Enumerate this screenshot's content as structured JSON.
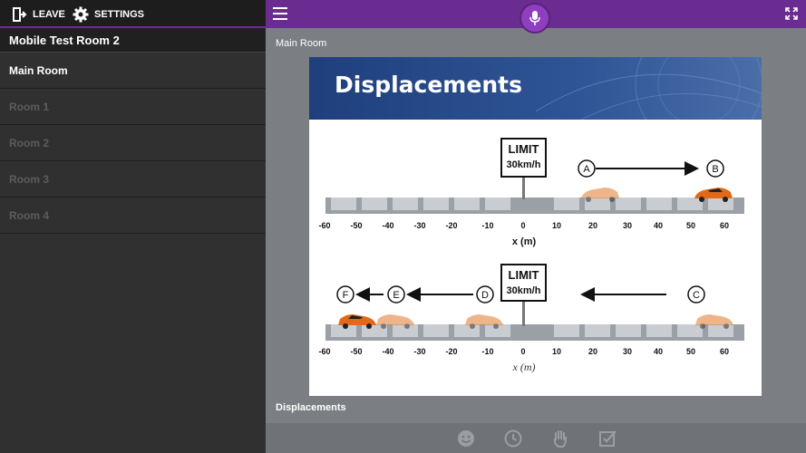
{
  "left_panel": {
    "leave_label": "LEAVE",
    "settings_label": "SETTINGS",
    "room_title": "Mobile Test Room 2",
    "rooms": [
      "Main Room",
      "Room 1",
      "Room 2",
      "Room 3",
      "Room 4"
    ]
  },
  "main": {
    "presentation_label": "Main Room",
    "footer_title": "Displacements",
    "slide": {
      "title": "Displacements",
      "sign_line1": "LIMIT",
      "sign_line2": "30km/h",
      "axis_ticks": [
        "-60",
        "-50",
        "-40",
        "-30",
        "-20",
        "-10",
        "0",
        "10",
        "20",
        "30",
        "40",
        "50",
        "60"
      ],
      "axis_label_top": "x (m)",
      "axis_label_bottom": "x (m)",
      "points_top": [
        "A",
        "B"
      ],
      "points_bottom": [
        "F",
        "E",
        "D",
        "C"
      ]
    }
  },
  "colors": {
    "accent": "#6a2c91",
    "slide_header": "#2a4a86"
  },
  "icons": [
    "leave-icon",
    "gear-icon",
    "menu-icon",
    "microphone-icon",
    "expand-icon",
    "smiley-icon",
    "clock-icon",
    "raise-hand-icon",
    "checkbox-icon"
  ]
}
